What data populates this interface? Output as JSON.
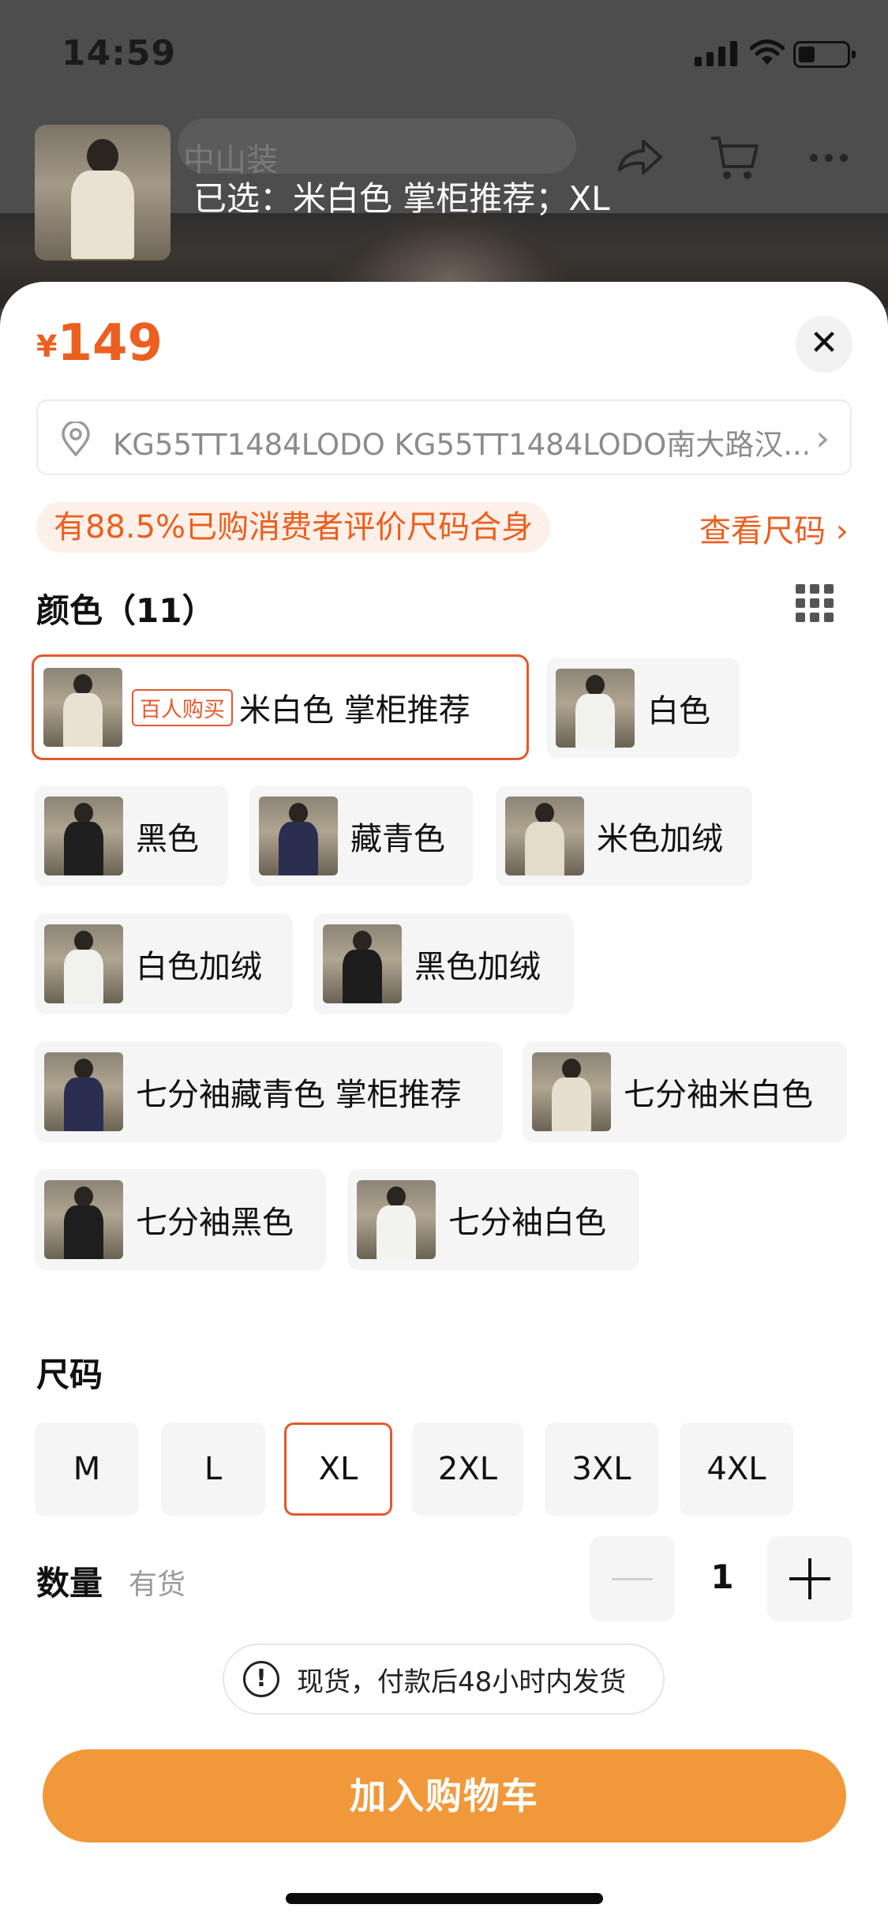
{
  "status_bar": {
    "time": "14:59"
  },
  "header": {
    "product_name": "中山装",
    "selected_text": "已选：米白色 掌柜推荐；XL"
  },
  "sheet": {
    "currency": "¥",
    "price": "149",
    "address": "KG55TT1484LODO KG55TT1484LODO南大路汉...",
    "size_fit_text": "有88.5%已购消费者评价尺码合身",
    "size_chart_link": "查看尺码 ›",
    "color_title": "颜色（11）",
    "colors": [
      {
        "label": "米白色 掌柜推荐",
        "tag": "百人购买",
        "selected": true,
        "shirt": "#e9e2d2"
      },
      {
        "label": "白色",
        "shirt": "#f1f1ee"
      },
      {
        "label": "黑色",
        "shirt": "#1f1f1f"
      },
      {
        "label": "藏青色",
        "shirt": "#2a2f4f"
      },
      {
        "label": "米色加绒",
        "shirt": "#e2dccb"
      },
      {
        "label": "白色加绒",
        "shirt": "#f0f0ec"
      },
      {
        "label": "黑色加绒",
        "shirt": "#1d1d1d"
      },
      {
        "label": "七分袖藏青色 掌柜推荐",
        "shirt": "#2a2f52"
      },
      {
        "label": "七分袖米白色",
        "shirt": "#e6dfcf"
      },
      {
        "label": "七分袖黑色",
        "shirt": "#1e1e1e"
      },
      {
        "label": "七分袖白色",
        "shirt": "#f2f2ef"
      }
    ],
    "size_title": "尺码",
    "sizes": [
      "M",
      "L",
      "XL",
      "2XL",
      "3XL",
      "4XL"
    ],
    "selected_size": "XL",
    "quantity_label": "数量",
    "stock_status": "有货",
    "quantity": "1",
    "shipping_notice": "现货，付款后48小时内发货",
    "add_to_cart": "加入购物车"
  },
  "colors": {
    "accent": "#ec5f1f",
    "cart_button": "#f1993a",
    "chip_bg": "#f5f5f5"
  },
  "icons": [
    "share-icon",
    "cart-icon",
    "more-icon",
    "close-icon",
    "location-pin-icon",
    "chevron-right-icon",
    "grid-view-icon",
    "minus-icon",
    "plus-icon",
    "info-icon"
  ]
}
